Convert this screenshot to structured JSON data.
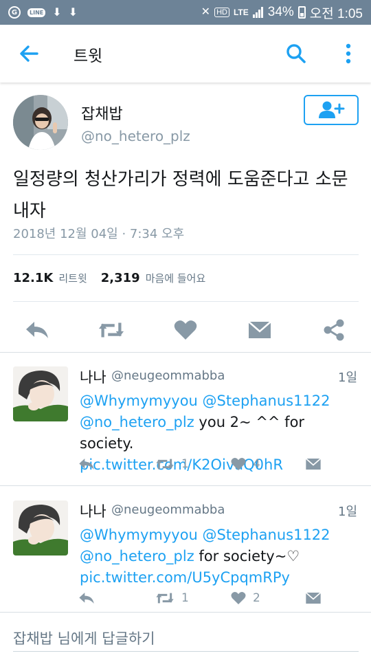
{
  "status_bar": {
    "left_icons": [
      "notification-icon",
      "line-app-icon",
      "download-icon",
      "download-icon"
    ],
    "line_label": "LINE",
    "hd_label": "HD",
    "lte_label": "LTE",
    "battery": "34%",
    "time": "오전 1:05"
  },
  "app_bar": {
    "title": "트윗",
    "back_icon": "arrow-back-icon",
    "search_icon": "search-icon",
    "more_icon": "more-vertical-icon"
  },
  "tweet": {
    "name": "잡채밥",
    "handle": "@no_hetero_plz",
    "text": "일정량의 청산가리가 정력에 도움준다고 소문내자",
    "timestamp": "2018년 12월 04일 · 7:34 오후",
    "retweet_count": "12.1K",
    "retweet_label": "리트윗",
    "like_count": "2,319",
    "like_label": "마음에 들어요"
  },
  "replies": [
    {
      "name": "나나",
      "handle": "@neugeommabba",
      "time": "1일",
      "mentions": "@Whymymyyou @Stephanus1122",
      "mention_inline": "@no_hetero_plz",
      "text": " you 2~ ^^ for society.",
      "link": "pic.twitter.com/K2OivaQ0hR",
      "retweets": "1",
      "likes": "4"
    },
    {
      "name": "나나",
      "handle": "@neugeommabba",
      "time": "1일",
      "mentions": "@Whymymyyou @Stephanus1122",
      "mention_inline": "@no_hetero_plz",
      "text": " for society~♡",
      "link": "pic.twitter.com/U5yCpqmRPy",
      "retweets": "1",
      "likes": "2"
    }
  ],
  "reply_bar": {
    "placeholder": "잡채밥 님에게 답글하기"
  },
  "colors": {
    "status_bar": "#6d8397",
    "accent": "#1da1f2",
    "icon_gray": "#8899a6",
    "text": "#14171a"
  }
}
